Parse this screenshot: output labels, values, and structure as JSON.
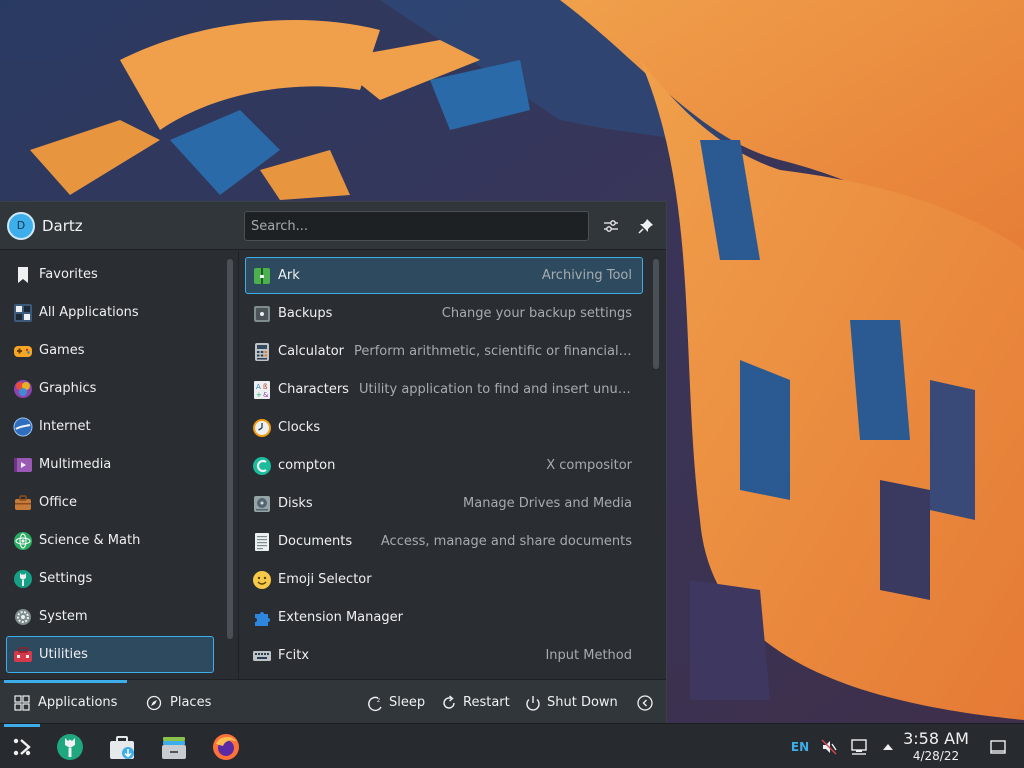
{
  "user": {
    "initial": "D",
    "name": "Dartz"
  },
  "search": {
    "placeholder": "Search..."
  },
  "header": {
    "configure_icon": "sliders-icon",
    "pin_icon": "pin-icon"
  },
  "categories": [
    {
      "label": "Favorites",
      "icon": "bookmark-icon"
    },
    {
      "label": "All Applications",
      "icon": "grid-icon"
    },
    {
      "label": "Games",
      "icon": "gamepad-icon"
    },
    {
      "label": "Graphics",
      "icon": "graphics-icon"
    },
    {
      "label": "Internet",
      "icon": "globe-icon"
    },
    {
      "label": "Multimedia",
      "icon": "multimedia-icon"
    },
    {
      "label": "Office",
      "icon": "briefcase-icon"
    },
    {
      "label": "Science & Math",
      "icon": "atom-icon"
    },
    {
      "label": "Settings",
      "icon": "wrench-icon"
    },
    {
      "label": "System",
      "icon": "gear-icon"
    },
    {
      "label": "Utilities",
      "icon": "toolbox-icon",
      "selected": true
    }
  ],
  "apps": [
    {
      "name": "Ark",
      "description": "Archiving Tool",
      "icon": "archive-icon",
      "selected": true
    },
    {
      "name": "Backups",
      "description": "Change your backup settings",
      "icon": "safe-icon"
    },
    {
      "name": "Calculator",
      "description": "Perform arithmetic, scientific or financial calc...",
      "icon": "calculator-icon"
    },
    {
      "name": "Characters",
      "description": "Utility application to find and insert unusual ...",
      "icon": "characters-icon"
    },
    {
      "name": "Clocks",
      "description": "",
      "icon": "clock-icon"
    },
    {
      "name": "compton",
      "description": "X compositor",
      "icon": "compton-icon"
    },
    {
      "name": "Disks",
      "description": "Manage Drives and Media",
      "icon": "disk-icon"
    },
    {
      "name": "Documents",
      "description": "Access, manage and share documents",
      "icon": "document-icon"
    },
    {
      "name": "Emoji Selector",
      "description": "",
      "icon": "emoji-icon"
    },
    {
      "name": "Extension Manager",
      "description": "",
      "icon": "puzzle-icon"
    },
    {
      "name": "Fcitx",
      "description": "Input Method",
      "icon": "keyboard-icon"
    }
  ],
  "footer": {
    "applications": "Applications",
    "places": "Places",
    "sleep": "Sleep",
    "restart": "Restart",
    "shutdown": "Shut Down"
  },
  "taskbar": {
    "items": [
      "launcher-icon",
      "settings-app-icon",
      "discover-icon",
      "files-icon",
      "firefox-icon"
    ],
    "language": "EN",
    "time": "3:58 AM",
    "date": "4/28/22"
  },
  "colors": {
    "accent": "#3daee9",
    "panel": "#2a2e32",
    "header": "#31363b"
  }
}
